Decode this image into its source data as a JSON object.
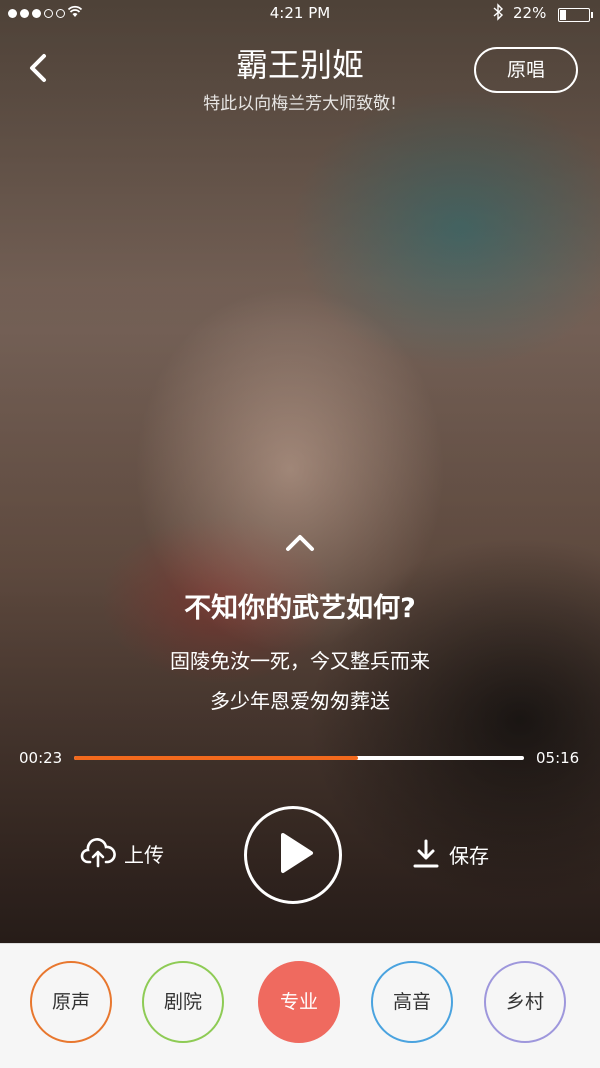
{
  "status_bar": {
    "time": "4:21 PM",
    "battery": "22%",
    "battery_level": 0.22,
    "signal_dots_filled": 3,
    "signal_dots_total": 5
  },
  "header": {
    "title": "霸王别姬",
    "subtitle": "特此以向梅兰芳大师致敬!",
    "original_button": "原唱"
  },
  "lyrics": {
    "current": "不知你的武艺如何?",
    "next": [
      "固陵免汝一死，今又整兵而来",
      "多少年恩爱匆匆葬送"
    ]
  },
  "player": {
    "current_time": "00:23",
    "total_time": "05:16",
    "progress": 0.63
  },
  "controls": {
    "upload_label": "上传",
    "save_label": "保存"
  },
  "modes": [
    {
      "label": "原声",
      "color": "#e8772e",
      "active": false
    },
    {
      "label": "剧院",
      "color": "#8ecb55",
      "active": false
    },
    {
      "label": "专业",
      "color": "#ef6a5f",
      "active": true
    },
    {
      "label": "高音",
      "color": "#4aa3df",
      "active": false
    },
    {
      "label": "乡村",
      "color": "#9e97dc",
      "active": false
    }
  ],
  "icons": {
    "back": "chevron-left-icon",
    "expand": "chevron-up-icon",
    "upload": "cloud-upload-icon",
    "play": "play-icon",
    "save": "download-icon",
    "wifi": "wifi-icon",
    "bluetooth": "bluetooth-icon"
  }
}
